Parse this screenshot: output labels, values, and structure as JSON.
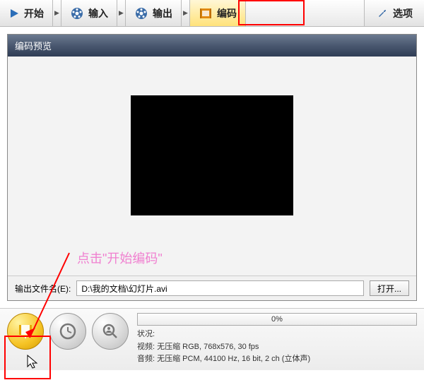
{
  "toolbar": {
    "start": "开始",
    "input": "输入",
    "output": "输出",
    "encode": "编码",
    "options": "选项"
  },
  "panel": {
    "title": "编码预览"
  },
  "annotation": "点击\"开始编码\"",
  "filename": {
    "label": "输出文件名(E):",
    "value": "D:\\我的文档\\幻灯片.avi",
    "open": "打开..."
  },
  "progress": "0%",
  "status": {
    "status_label": "状况:",
    "status_value": "",
    "video_label": "视频:",
    "video_value": "无压缩 RGB, 768x576, 30 fps",
    "audio_label": "音频:",
    "audio_value": "无压缩 PCM, 44100 Hz, 16 bit, 2 ch (立体声)"
  }
}
